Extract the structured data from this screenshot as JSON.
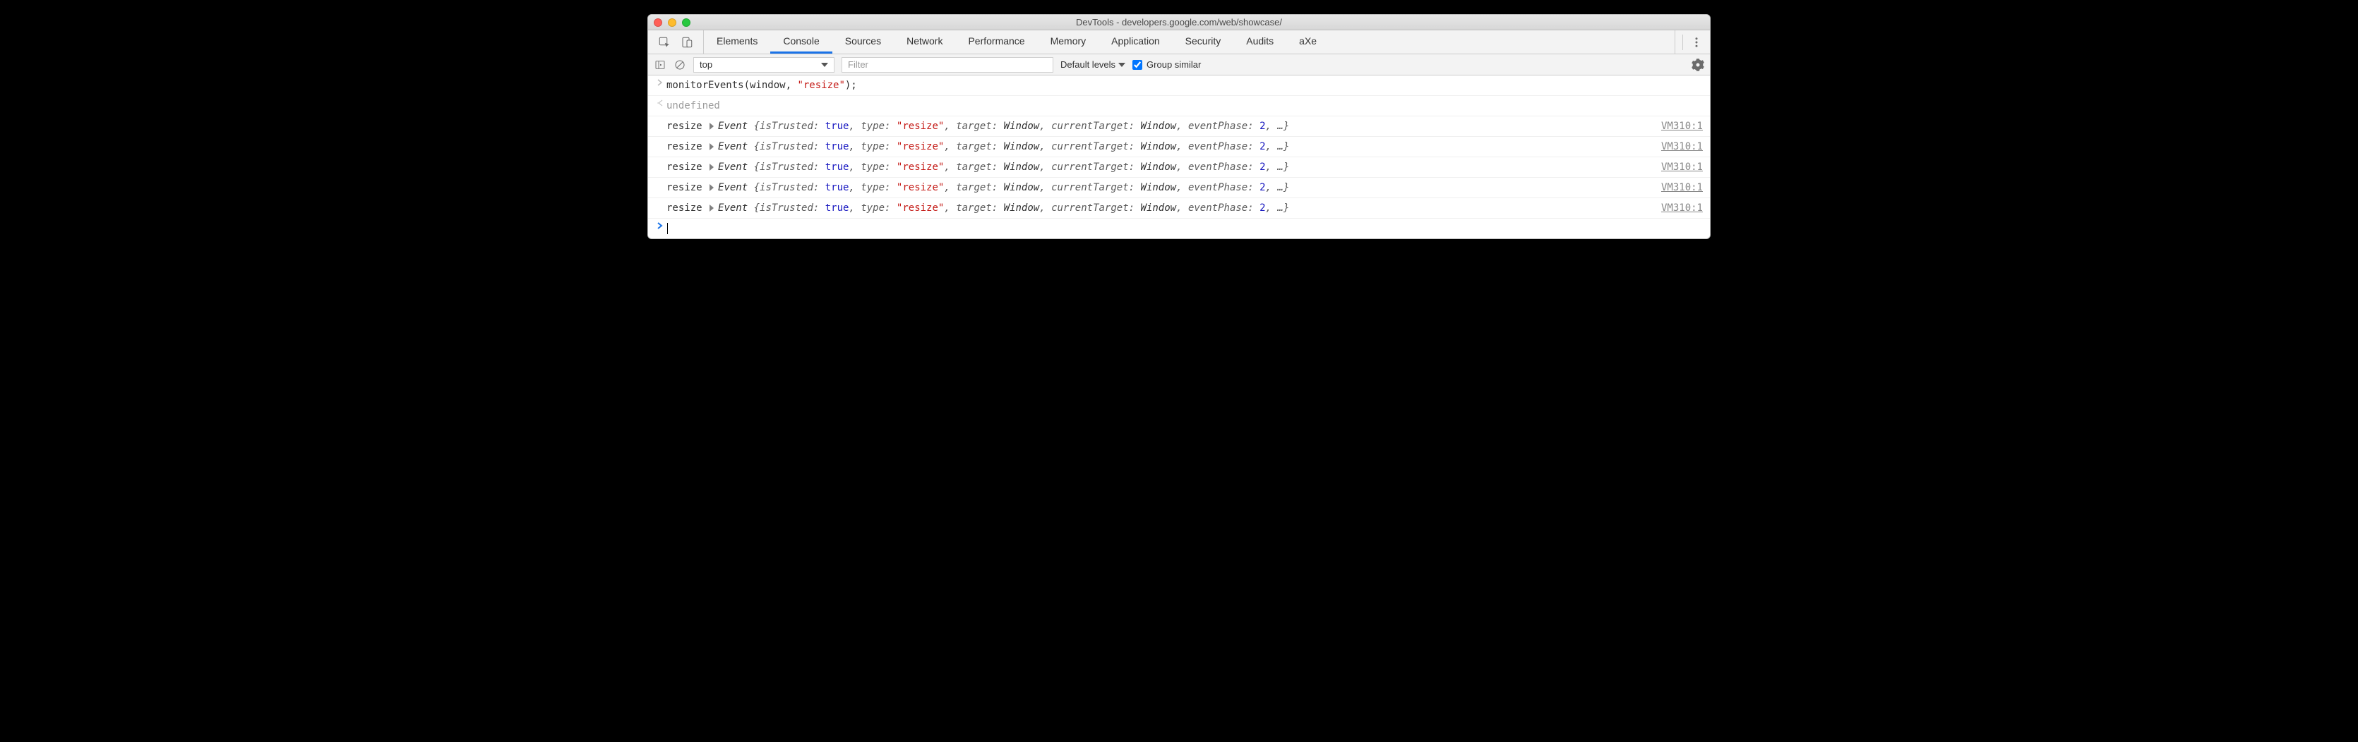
{
  "title": "DevTools - developers.google.com/web/showcase/",
  "tabs": [
    "Elements",
    "Console",
    "Sources",
    "Network",
    "Performance",
    "Memory",
    "Application",
    "Security",
    "Audits",
    "aXe"
  ],
  "active_tab": "Console",
  "filterbar": {
    "context": "top",
    "filter_placeholder": "Filter",
    "levels_label": "Default levels",
    "group_label": "Group similar",
    "group_checked": true
  },
  "input_line": "monitorEvents(window, \"resize\");",
  "return_line": "undefined",
  "events": [
    {
      "label": "resize",
      "cls": "Event",
      "props": {
        "isTrusted": "true",
        "type": "\"resize\"",
        "target": "Window",
        "currentTarget": "Window",
        "eventPhase": "2"
      },
      "source": "VM310:1"
    },
    {
      "label": "resize",
      "cls": "Event",
      "props": {
        "isTrusted": "true",
        "type": "\"resize\"",
        "target": "Window",
        "currentTarget": "Window",
        "eventPhase": "2"
      },
      "source": "VM310:1"
    },
    {
      "label": "resize",
      "cls": "Event",
      "props": {
        "isTrusted": "true",
        "type": "\"resize\"",
        "target": "Window",
        "currentTarget": "Window",
        "eventPhase": "2"
      },
      "source": "VM310:1"
    },
    {
      "label": "resize",
      "cls": "Event",
      "props": {
        "isTrusted": "true",
        "type": "\"resize\"",
        "target": "Window",
        "currentTarget": "Window",
        "eventPhase": "2"
      },
      "source": "VM310:1"
    },
    {
      "label": "resize",
      "cls": "Event",
      "props": {
        "isTrusted": "true",
        "type": "\"resize\"",
        "target": "Window",
        "currentTarget": "Window",
        "eventPhase": "2"
      },
      "source": "VM310:1"
    }
  ]
}
